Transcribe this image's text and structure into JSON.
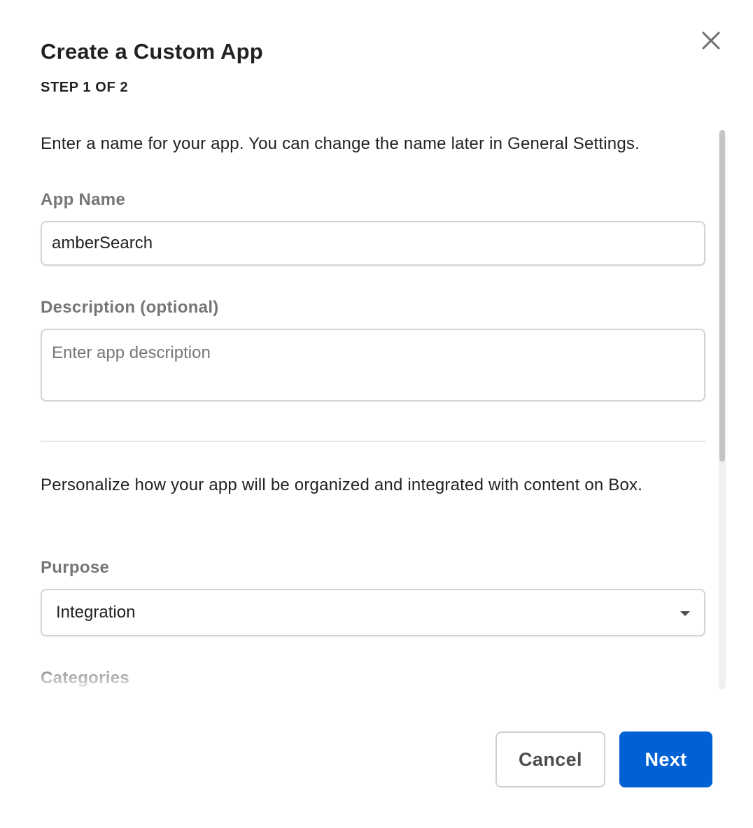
{
  "dialog": {
    "title": "Create a Custom App",
    "step": "STEP 1 OF 2",
    "close_icon": "close-icon"
  },
  "form": {
    "intro": "Enter a name for your app. You can change the name later in General Settings.",
    "app_name": {
      "label": "App Name",
      "value": "amberSearch"
    },
    "description": {
      "label": "Description (optional)",
      "value": "",
      "placeholder": "Enter app description"
    },
    "personalize_text": "Personalize how your app will be organized and integrated with content on Box.",
    "purpose": {
      "label": "Purpose",
      "selected": "Integration",
      "icon": "chevron-down-icon"
    },
    "categories": {
      "label": "Categories"
    }
  },
  "footer": {
    "cancel_label": "Cancel",
    "next_label": "Next"
  },
  "colors": {
    "primary": "#0061d5",
    "text": "#222222",
    "label": "#767676",
    "border": "#d4d4d4"
  }
}
